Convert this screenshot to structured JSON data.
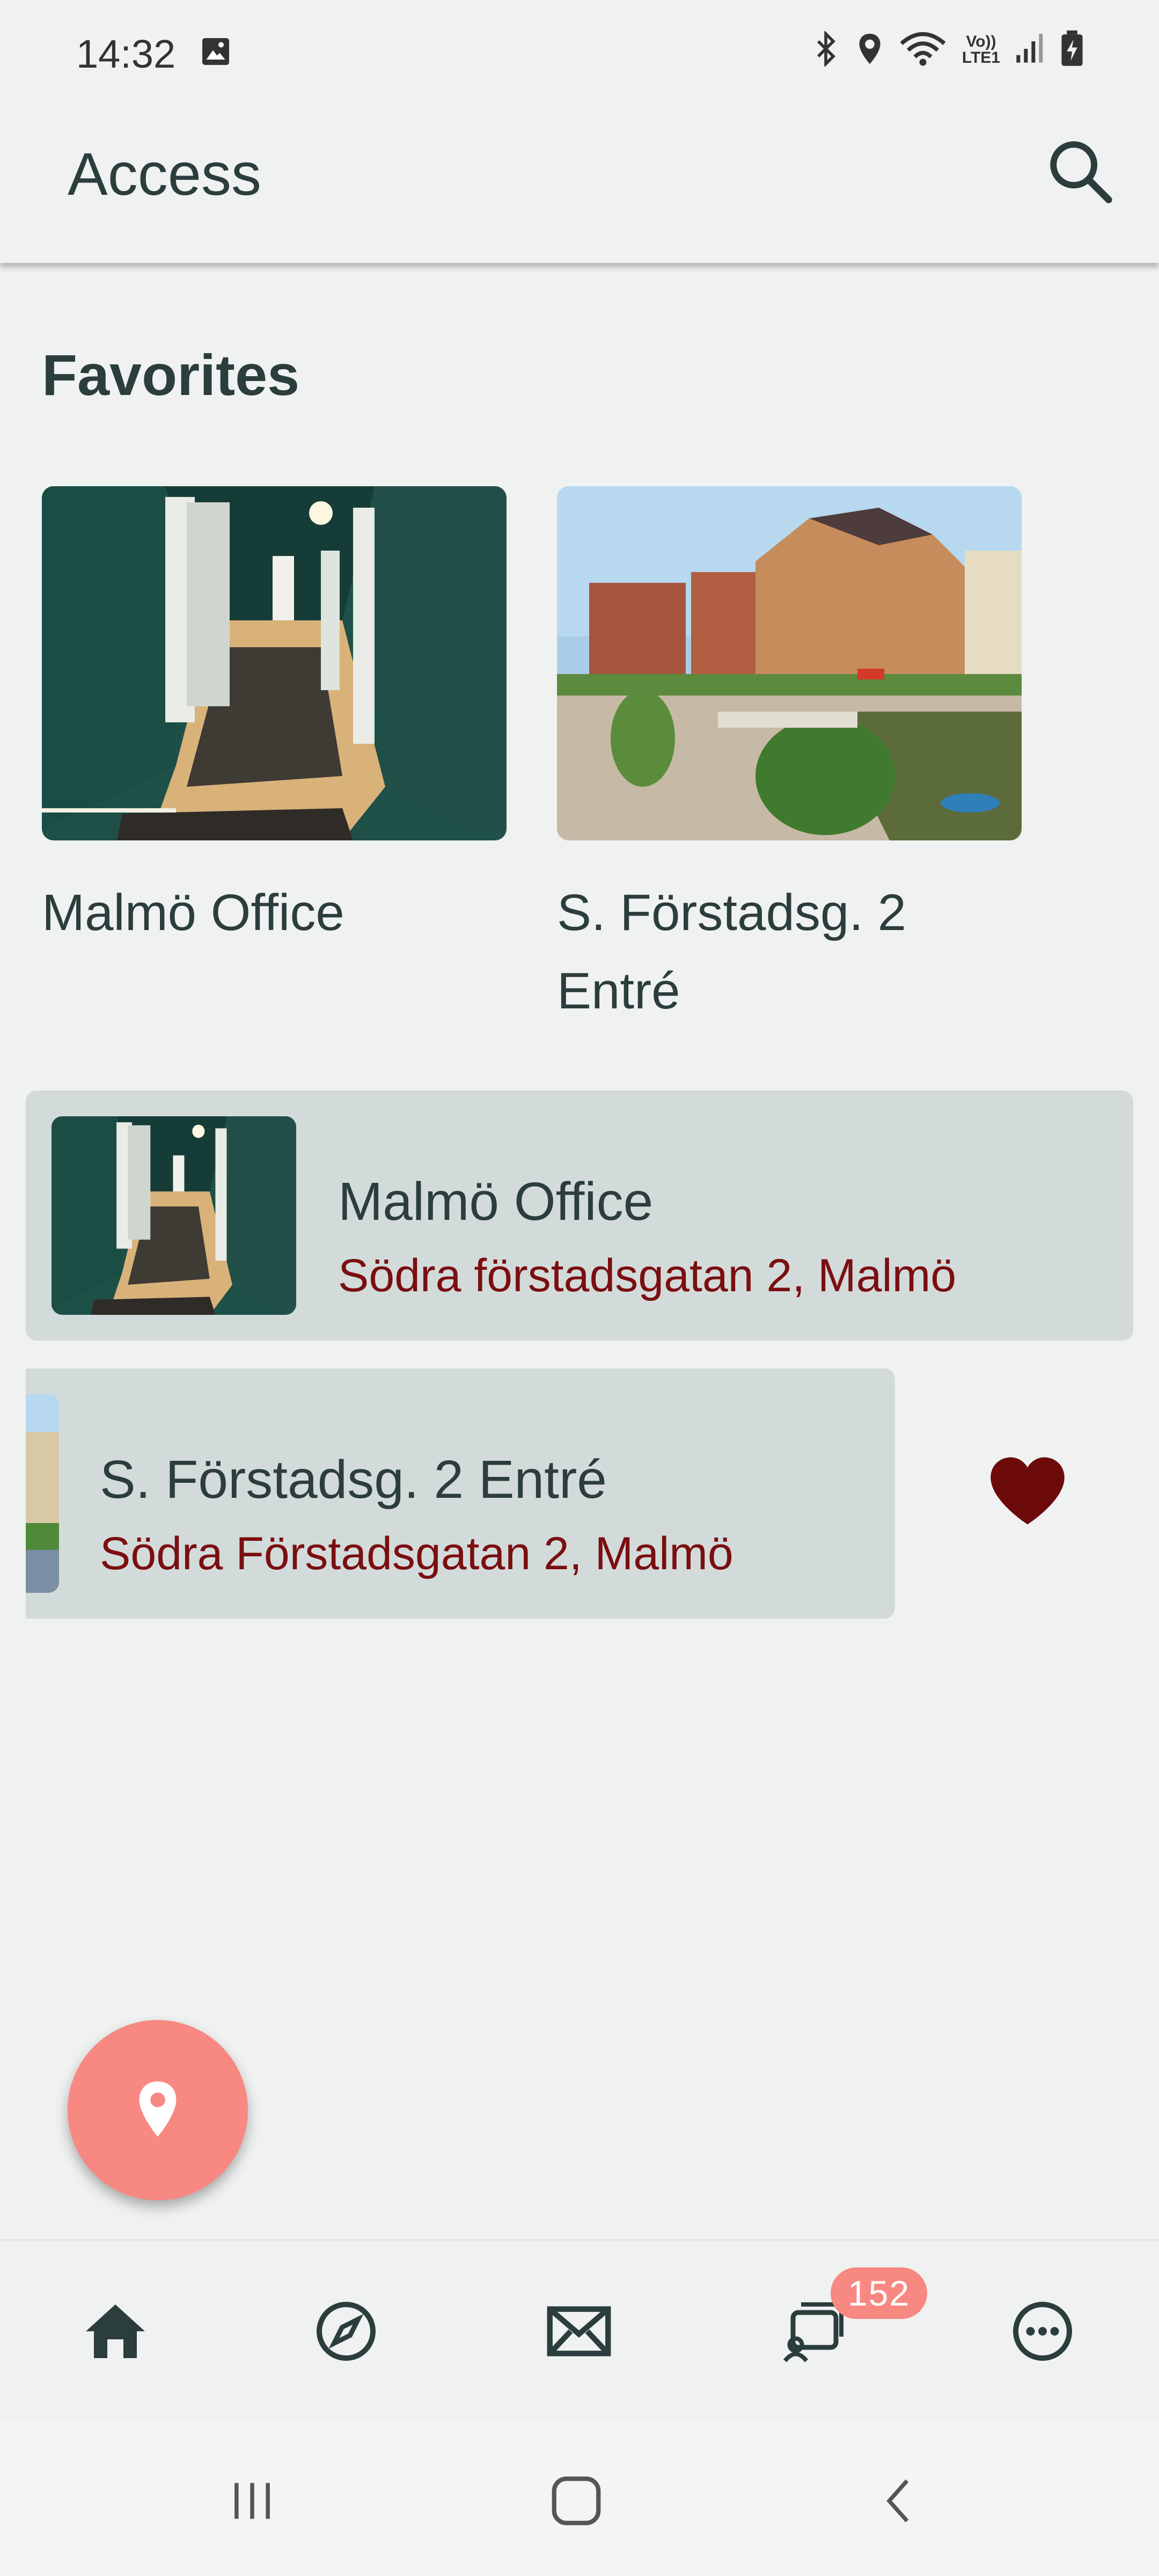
{
  "status_bar": {
    "time": "14:32",
    "icons": [
      "image-icon",
      "bluetooth-icon",
      "location-icon",
      "wifi-icon",
      "volte-icon",
      "signal-icon",
      "battery-charging-icon"
    ],
    "volte_text_top": "Vo))",
    "volte_text_bottom": "LTE1"
  },
  "app_bar": {
    "title": "Access",
    "search_icon": "search-icon"
  },
  "favorites": {
    "title": "Favorites",
    "items": [
      {
        "label": "Malmö Office",
        "image": "hallway-photo"
      },
      {
        "label": "S. Förstadsg. 2 Entré",
        "image": "city-street-photo"
      }
    ]
  },
  "list": {
    "items": [
      {
        "title": "Malmö Office",
        "address": "Södra förstadsgatan 2, Malmö",
        "image": "hallway-photo"
      },
      {
        "title": "S. Förstadsg. 2 Entré",
        "address": "Södra Förstadsgatan 2, Malmö",
        "image": "city-street-photo",
        "favorite_icon": "heart-icon"
      }
    ]
  },
  "fab": {
    "icon": "location-pin-icon"
  },
  "bottom_nav": {
    "items": [
      {
        "icon": "home-icon"
      },
      {
        "icon": "compass-icon"
      },
      {
        "icon": "mail-icon"
      },
      {
        "icon": "cards-icon",
        "badge": "152"
      },
      {
        "icon": "more-icon"
      }
    ]
  },
  "colors": {
    "background": "#eff2f1",
    "text": "#2b3d3c",
    "accent_red": "#7a0e10",
    "fab": "#f88882",
    "list_bg": "#d3dbda"
  }
}
